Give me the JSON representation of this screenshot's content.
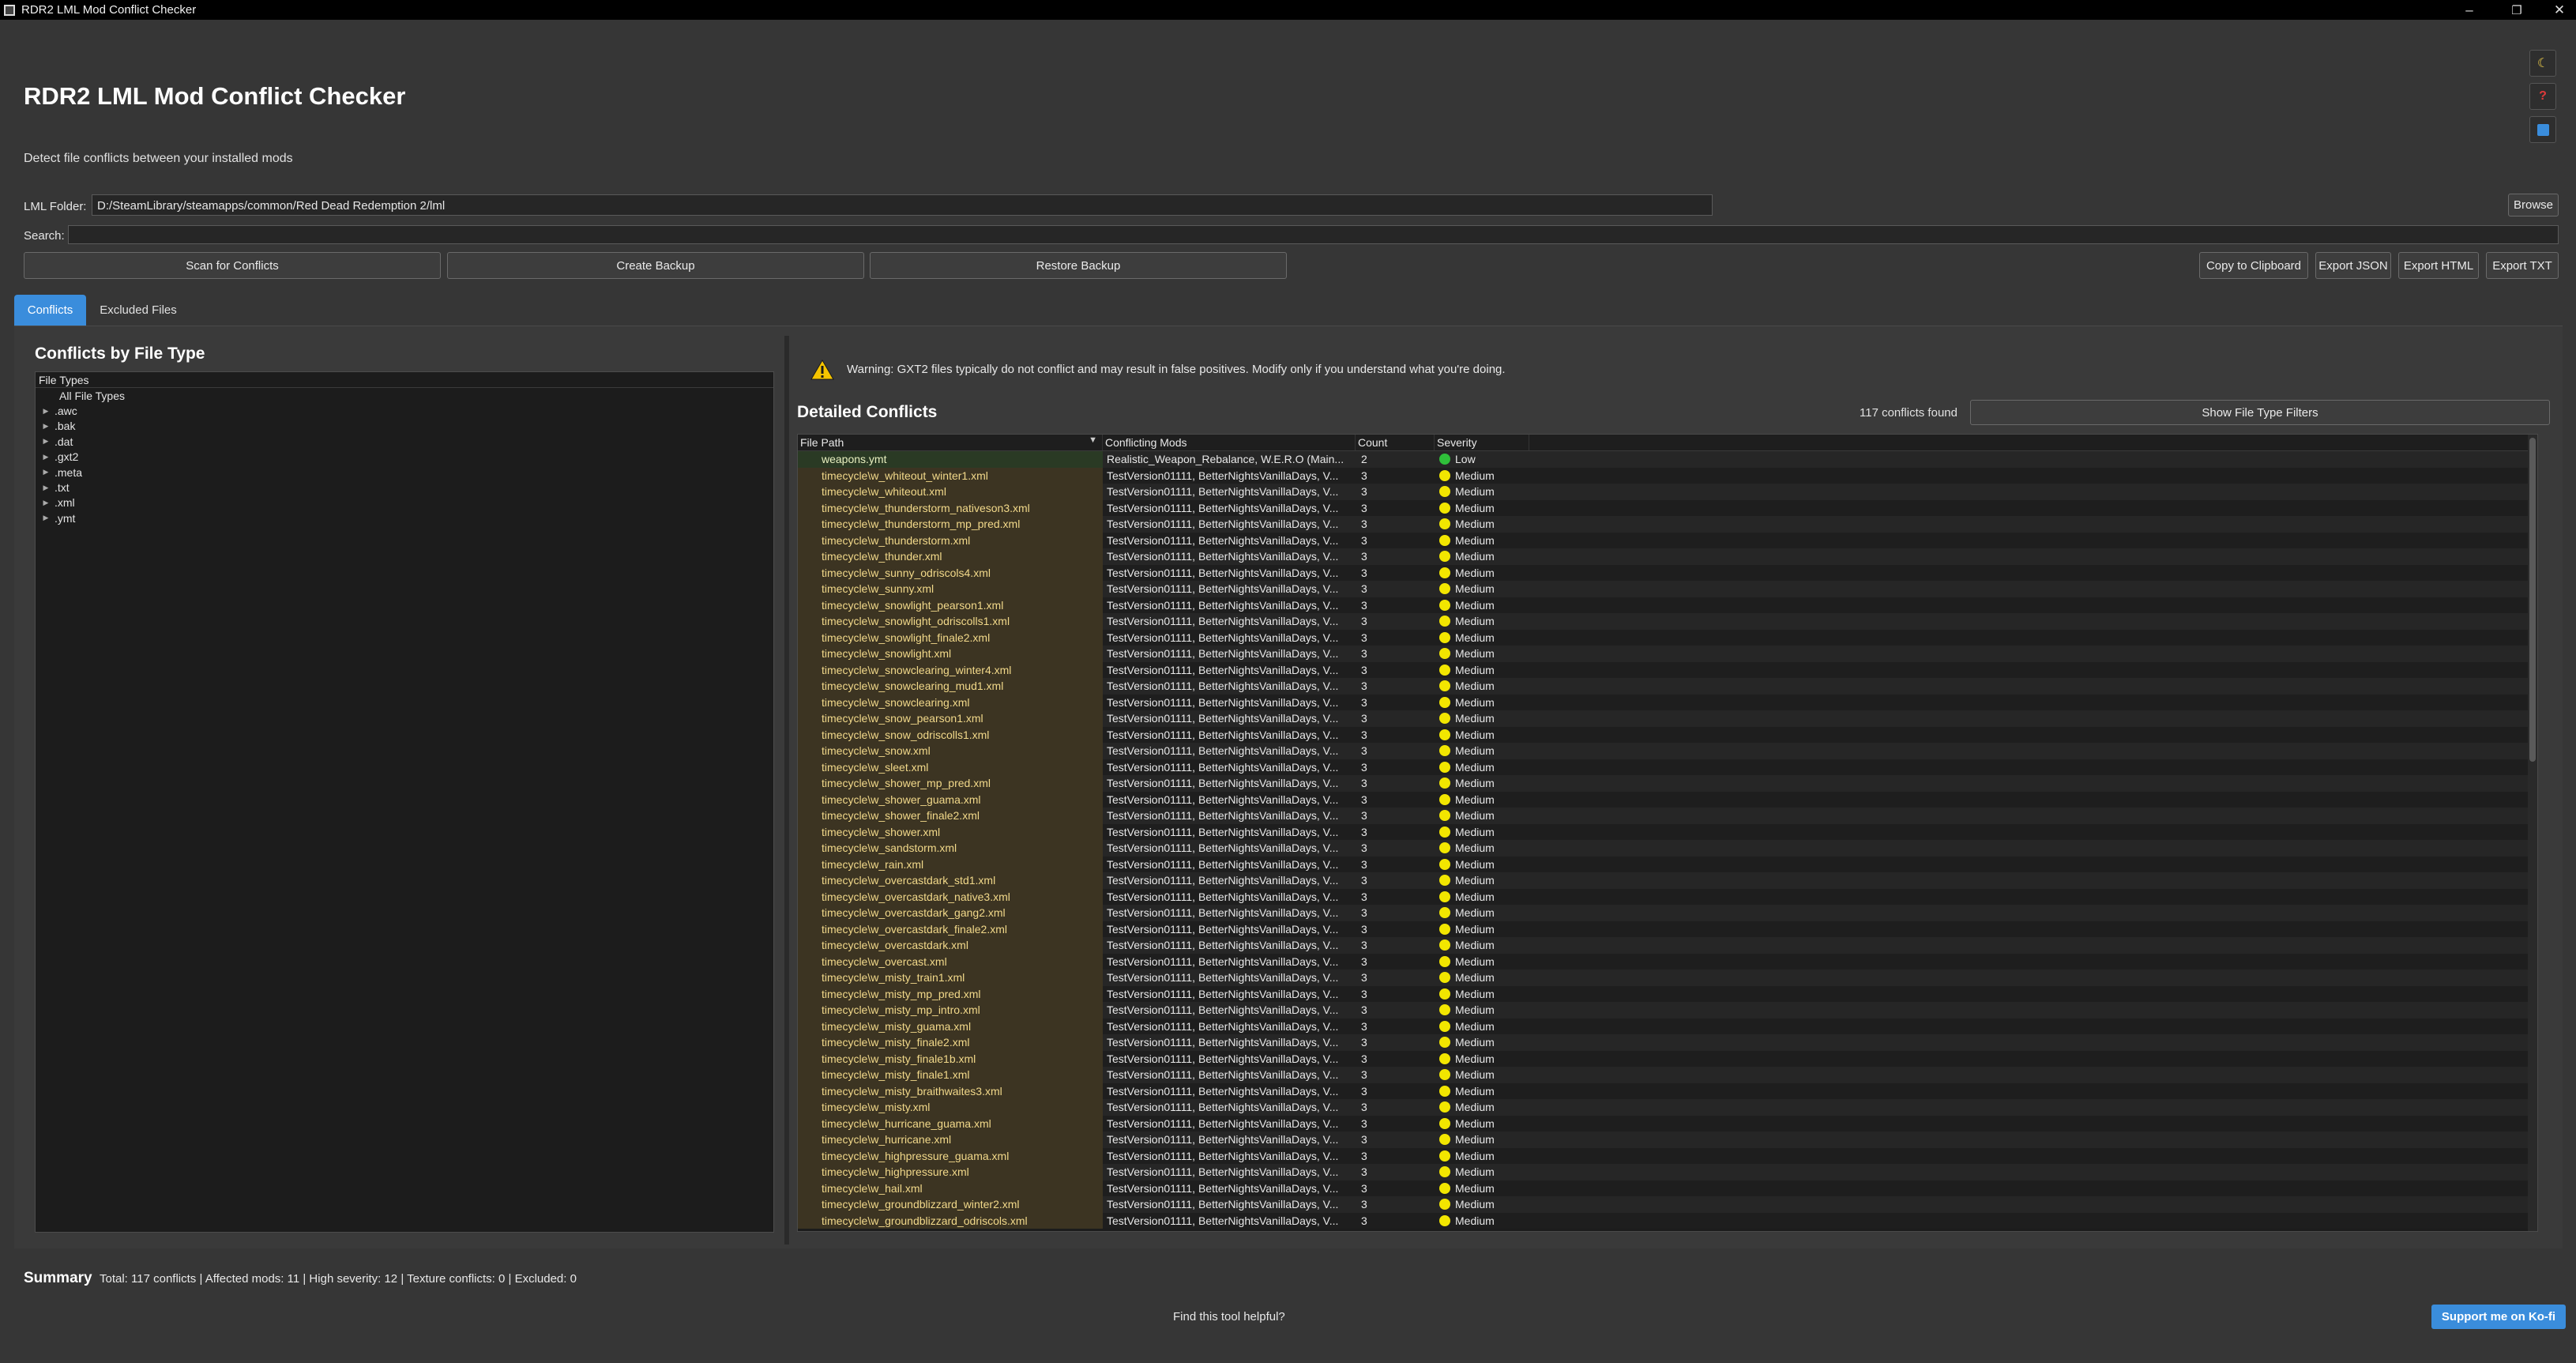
{
  "window": {
    "title": "RDR2 LML Mod Conflict Checker",
    "minimize": "–",
    "maximize": "❐",
    "close": "✕"
  },
  "header": {
    "title": "RDR2 LML Mod Conflict Checker",
    "subtitle": "Detect file conflicts between your installed mods"
  },
  "side_icons": [
    "moon-icon",
    "help-icon",
    "info-icon"
  ],
  "folder": {
    "label": "LML Folder:",
    "value": "D:/SteamLibrary/steamapps/common/Red Dead Redemption 2/lml",
    "browse": "Browse"
  },
  "search": {
    "label": "Search:",
    "value": ""
  },
  "actions": {
    "scan": "Scan for Conflicts",
    "backup": "Create Backup",
    "restore": "Restore Backup",
    "copy": "Copy to Clipboard",
    "json": "Export JSON",
    "html": "Export HTML",
    "txt": "Export TXT"
  },
  "tabs": {
    "conflicts": "Conflicts",
    "excluded": "Excluded Files"
  },
  "left": {
    "heading": "Conflicts by File Type",
    "tree_header": "File Types",
    "all": "All File Types",
    "types": [
      ".awc",
      ".bak",
      ".dat",
      ".gxt2",
      ".meta",
      ".txt",
      ".xml",
      ".ymt"
    ]
  },
  "warning": "Warning: GXT2 files typically do not conflict and may result in false positives. Modify only if you understand what you're doing.",
  "right": {
    "heading": "Detailed Conflicts",
    "count": "117 conflicts found",
    "filter_btn": "Show File Type Filters",
    "columns": [
      "File Path",
      "Conflicting Mods",
      "Count",
      "Severity"
    ]
  },
  "colors": {
    "accent": "#3a8ddc",
    "low": "#2fbf3a",
    "medium": "#f2e600"
  },
  "rows": [
    {
      "path": "weapons.ymt",
      "mods": "Realistic_Weapon_Rebalance, W.E.R.O (Main...",
      "count": "2",
      "severity": "Low"
    },
    {
      "path": "timecycle\\w_whiteout_winter1.xml",
      "mods": "TestVersion01111, BetterNightsVanillaDays, V...",
      "count": "3",
      "severity": "Medium"
    },
    {
      "path": "timecycle\\w_whiteout.xml",
      "mods": "TestVersion01111, BetterNightsVanillaDays, V...",
      "count": "3",
      "severity": "Medium"
    },
    {
      "path": "timecycle\\w_thunderstorm_nativeson3.xml",
      "mods": "TestVersion01111, BetterNightsVanillaDays, V...",
      "count": "3",
      "severity": "Medium"
    },
    {
      "path": "timecycle\\w_thunderstorm_mp_pred.xml",
      "mods": "TestVersion01111, BetterNightsVanillaDays, V...",
      "count": "3",
      "severity": "Medium"
    },
    {
      "path": "timecycle\\w_thunderstorm.xml",
      "mods": "TestVersion01111, BetterNightsVanillaDays, V...",
      "count": "3",
      "severity": "Medium"
    },
    {
      "path": "timecycle\\w_thunder.xml",
      "mods": "TestVersion01111, BetterNightsVanillaDays, V...",
      "count": "3",
      "severity": "Medium"
    },
    {
      "path": "timecycle\\w_sunny_odriscols4.xml",
      "mods": "TestVersion01111, BetterNightsVanillaDays, V...",
      "count": "3",
      "severity": "Medium"
    },
    {
      "path": "timecycle\\w_sunny.xml",
      "mods": "TestVersion01111, BetterNightsVanillaDays, V...",
      "count": "3",
      "severity": "Medium"
    },
    {
      "path": "timecycle\\w_snowlight_pearson1.xml",
      "mods": "TestVersion01111, BetterNightsVanillaDays, V...",
      "count": "3",
      "severity": "Medium"
    },
    {
      "path": "timecycle\\w_snowlight_odriscolls1.xml",
      "mods": "TestVersion01111, BetterNightsVanillaDays, V...",
      "count": "3",
      "severity": "Medium"
    },
    {
      "path": "timecycle\\w_snowlight_finale2.xml",
      "mods": "TestVersion01111, BetterNightsVanillaDays, V...",
      "count": "3",
      "severity": "Medium"
    },
    {
      "path": "timecycle\\w_snowlight.xml",
      "mods": "TestVersion01111, BetterNightsVanillaDays, V...",
      "count": "3",
      "severity": "Medium"
    },
    {
      "path": "timecycle\\w_snowclearing_winter4.xml",
      "mods": "TestVersion01111, BetterNightsVanillaDays, V...",
      "count": "3",
      "severity": "Medium"
    },
    {
      "path": "timecycle\\w_snowclearing_mud1.xml",
      "mods": "TestVersion01111, BetterNightsVanillaDays, V...",
      "count": "3",
      "severity": "Medium"
    },
    {
      "path": "timecycle\\w_snowclearing.xml",
      "mods": "TestVersion01111, BetterNightsVanillaDays, V...",
      "count": "3",
      "severity": "Medium"
    },
    {
      "path": "timecycle\\w_snow_pearson1.xml",
      "mods": "TestVersion01111, BetterNightsVanillaDays, V...",
      "count": "3",
      "severity": "Medium"
    },
    {
      "path": "timecycle\\w_snow_odriscolls1.xml",
      "mods": "TestVersion01111, BetterNightsVanillaDays, V...",
      "count": "3",
      "severity": "Medium"
    },
    {
      "path": "timecycle\\w_snow.xml",
      "mods": "TestVersion01111, BetterNightsVanillaDays, V...",
      "count": "3",
      "severity": "Medium"
    },
    {
      "path": "timecycle\\w_sleet.xml",
      "mods": "TestVersion01111, BetterNightsVanillaDays, V...",
      "count": "3",
      "severity": "Medium"
    },
    {
      "path": "timecycle\\w_shower_mp_pred.xml",
      "mods": "TestVersion01111, BetterNightsVanillaDays, V...",
      "count": "3",
      "severity": "Medium"
    },
    {
      "path": "timecycle\\w_shower_guama.xml",
      "mods": "TestVersion01111, BetterNightsVanillaDays, V...",
      "count": "3",
      "severity": "Medium"
    },
    {
      "path": "timecycle\\w_shower_finale2.xml",
      "mods": "TestVersion01111, BetterNightsVanillaDays, V...",
      "count": "3",
      "severity": "Medium"
    },
    {
      "path": "timecycle\\w_shower.xml",
      "mods": "TestVersion01111, BetterNightsVanillaDays, V...",
      "count": "3",
      "severity": "Medium"
    },
    {
      "path": "timecycle\\w_sandstorm.xml",
      "mods": "TestVersion01111, BetterNightsVanillaDays, V...",
      "count": "3",
      "severity": "Medium"
    },
    {
      "path": "timecycle\\w_rain.xml",
      "mods": "TestVersion01111, BetterNightsVanillaDays, V...",
      "count": "3",
      "severity": "Medium"
    },
    {
      "path": "timecycle\\w_overcastdark_std1.xml",
      "mods": "TestVersion01111, BetterNightsVanillaDays, V...",
      "count": "3",
      "severity": "Medium"
    },
    {
      "path": "timecycle\\w_overcastdark_native3.xml",
      "mods": "TestVersion01111, BetterNightsVanillaDays, V...",
      "count": "3",
      "severity": "Medium"
    },
    {
      "path": "timecycle\\w_overcastdark_gang2.xml",
      "mods": "TestVersion01111, BetterNightsVanillaDays, V...",
      "count": "3",
      "severity": "Medium"
    },
    {
      "path": "timecycle\\w_overcastdark_finale2.xml",
      "mods": "TestVersion01111, BetterNightsVanillaDays, V...",
      "count": "3",
      "severity": "Medium"
    },
    {
      "path": "timecycle\\w_overcastdark.xml",
      "mods": "TestVersion01111, BetterNightsVanillaDays, V...",
      "count": "3",
      "severity": "Medium"
    },
    {
      "path": "timecycle\\w_overcast.xml",
      "mods": "TestVersion01111, BetterNightsVanillaDays, V...",
      "count": "3",
      "severity": "Medium"
    },
    {
      "path": "timecycle\\w_misty_train1.xml",
      "mods": "TestVersion01111, BetterNightsVanillaDays, V...",
      "count": "3",
      "severity": "Medium"
    },
    {
      "path": "timecycle\\w_misty_mp_pred.xml",
      "mods": "TestVersion01111, BetterNightsVanillaDays, V...",
      "count": "3",
      "severity": "Medium"
    },
    {
      "path": "timecycle\\w_misty_mp_intro.xml",
      "mods": "TestVersion01111, BetterNightsVanillaDays, V...",
      "count": "3",
      "severity": "Medium"
    },
    {
      "path": "timecycle\\w_misty_guama.xml",
      "mods": "TestVersion01111, BetterNightsVanillaDays, V...",
      "count": "3",
      "severity": "Medium"
    },
    {
      "path": "timecycle\\w_misty_finale2.xml",
      "mods": "TestVersion01111, BetterNightsVanillaDays, V...",
      "count": "3",
      "severity": "Medium"
    },
    {
      "path": "timecycle\\w_misty_finale1b.xml",
      "mods": "TestVersion01111, BetterNightsVanillaDays, V...",
      "count": "3",
      "severity": "Medium"
    },
    {
      "path": "timecycle\\w_misty_finale1.xml",
      "mods": "TestVersion01111, BetterNightsVanillaDays, V...",
      "count": "3",
      "severity": "Medium"
    },
    {
      "path": "timecycle\\w_misty_braithwaites3.xml",
      "mods": "TestVersion01111, BetterNightsVanillaDays, V...",
      "count": "3",
      "severity": "Medium"
    },
    {
      "path": "timecycle\\w_misty.xml",
      "mods": "TestVersion01111, BetterNightsVanillaDays, V...",
      "count": "3",
      "severity": "Medium"
    },
    {
      "path": "timecycle\\w_hurricane_guama.xml",
      "mods": "TestVersion01111, BetterNightsVanillaDays, V...",
      "count": "3",
      "severity": "Medium"
    },
    {
      "path": "timecycle\\w_hurricane.xml",
      "mods": "TestVersion01111, BetterNightsVanillaDays, V...",
      "count": "3",
      "severity": "Medium"
    },
    {
      "path": "timecycle\\w_highpressure_guama.xml",
      "mods": "TestVersion01111, BetterNightsVanillaDays, V...",
      "count": "3",
      "severity": "Medium"
    },
    {
      "path": "timecycle\\w_highpressure.xml",
      "mods": "TestVersion01111, BetterNightsVanillaDays, V...",
      "count": "3",
      "severity": "Medium"
    },
    {
      "path": "timecycle\\w_hail.xml",
      "mods": "TestVersion01111, BetterNightsVanillaDays, V...",
      "count": "3",
      "severity": "Medium"
    },
    {
      "path": "timecycle\\w_groundblizzard_winter2.xml",
      "mods": "TestVersion01111, BetterNightsVanillaDays, V...",
      "count": "3",
      "severity": "Medium"
    },
    {
      "path": "timecycle\\w_groundblizzard_odriscols.xml",
      "mods": "TestVersion01111, BetterNightsVanillaDays, V...",
      "count": "3",
      "severity": "Medium"
    }
  ],
  "summary": {
    "label": "Summary",
    "text": "Total: 117 conflicts | Affected mods: 11 | High severity: 12 | Texture conflicts: 0 | Excluded: 0"
  },
  "footer": {
    "helpful": "Find this tool helpful?",
    "kofi": "Support me on Ko-fi"
  }
}
